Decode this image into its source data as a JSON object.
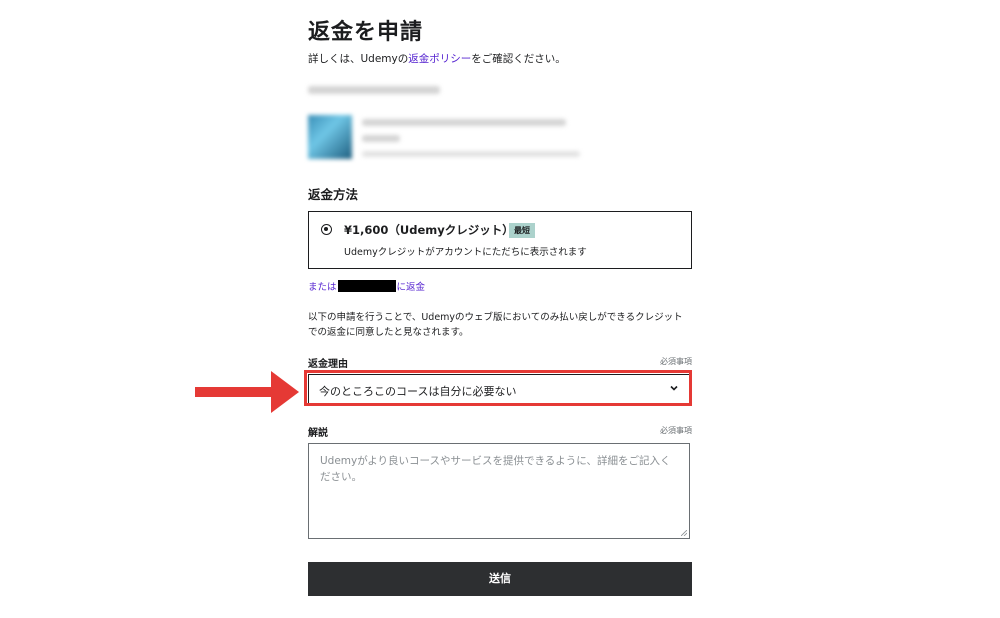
{
  "header": {
    "title": "返金を申請",
    "subtitle_prefix": "詳しくは、Udemyの",
    "policy_link": "返金ポリシー",
    "subtitle_suffix": "をご確認ください。"
  },
  "refund_method": {
    "heading": "返金方法",
    "option_label": "¥1,600（Udemyクレジット）",
    "badge": "最短",
    "option_desc": "Udemyクレジットがアカウントにただちに表示されます",
    "alt_prefix": "または",
    "alt_suffix": "に返金"
  },
  "agreement_text": "以下の申請を行うことで、Udemyのウェブ版においてのみ払い戻しができるクレジットでの返金に同意したと見なされます。",
  "reason": {
    "label": "返金理由",
    "required": "必須事項",
    "selected": "今のところこのコースは自分に必要ない"
  },
  "comment": {
    "label": "解説",
    "required": "必須事項",
    "placeholder": "Udemyがより良いコースやサービスを提供できるように、詳細をご記入ください。"
  },
  "submit_label": "送信",
  "colors": {
    "link": "#5624d0",
    "badge": "#acd2cc",
    "highlight": "#e53935",
    "button": "#2d2f31"
  },
  "icons": [
    "radio-selected-icon",
    "chevron-down-icon",
    "resize-grip-icon",
    "red-arrow-icon"
  ]
}
